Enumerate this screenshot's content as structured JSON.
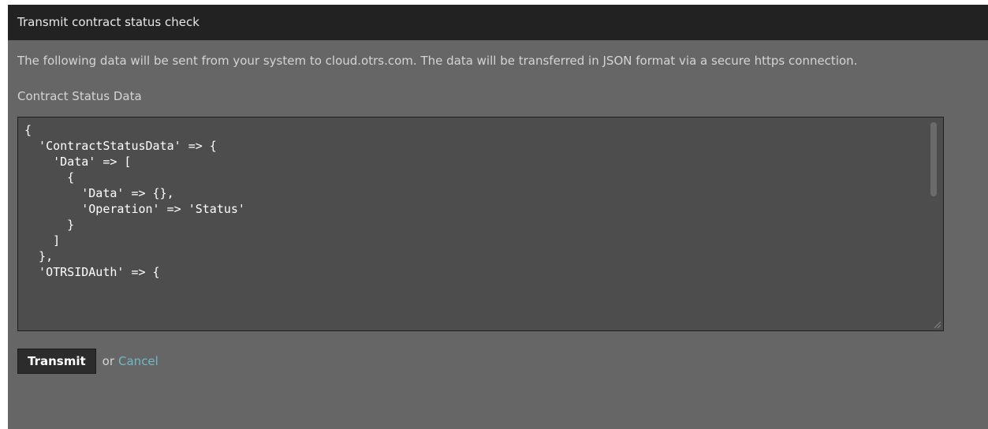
{
  "dialog": {
    "title": "Transmit contract status check",
    "intro": "The following data will be sent from your system to cloud.otrs.com. The data will be transferred in JSON format via a secure https connection.",
    "section_label": "Contract Status Data",
    "code": "{\n  'ContractStatusData' => {\n    'Data' => [\n      {\n        'Data' => {},\n        'Operation' => 'Status'\n      }\n    ]\n  },\n  'OTRSIDAuth' => {",
    "actions": {
      "transmit_label": "Transmit",
      "or_text": "or",
      "cancel_label": "Cancel"
    }
  },
  "colors": {
    "header_bg": "#222222",
    "dialog_bg": "#666666",
    "code_bg": "#4d4d4d",
    "link": "#6fb8c8"
  }
}
